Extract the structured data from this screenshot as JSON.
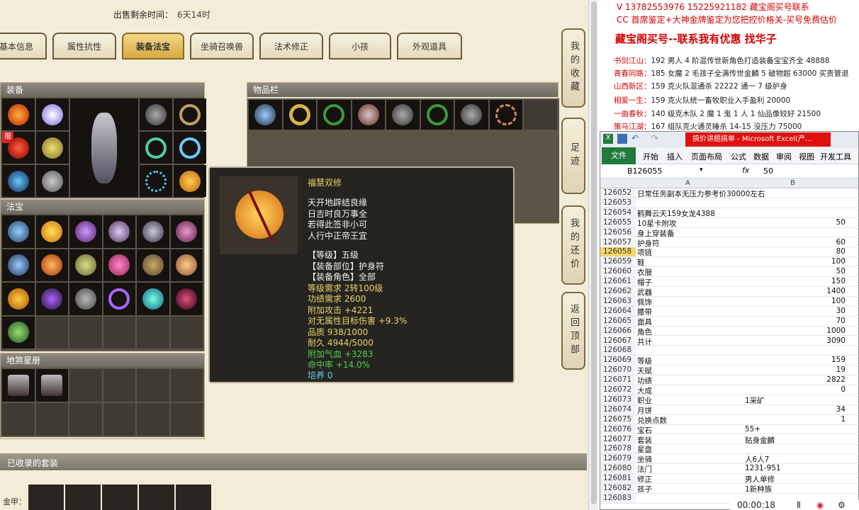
{
  "game": {
    "sale_label": "出售剩余时间：",
    "sale_value": "6天14时",
    "tabs": [
      "基本信息",
      "属性抗性",
      "装备法宝",
      "坐骑召唤兽",
      "法术修正",
      "小孩",
      "外观道具"
    ],
    "active_tab": "装备法宝",
    "sections": {
      "equip": "装备",
      "inventory": "物品栏",
      "fabao": "法宝",
      "dishaxing": "地煞星册",
      "suit": "已收录的套装",
      "suit_label": "金甲："
    },
    "limit_badge": "限",
    "side_buttons": [
      "我的收藏",
      "足迹",
      "我的还价",
      "返回顶部"
    ],
    "tooltip": {
      "name": "福慧双修",
      "poem": [
        "天开地辟结良缘",
        "日吉时良万事全",
        "若得此签非小可",
        "人行中正帝王宜"
      ],
      "attrs": [
        {
          "t": "【等级】五级",
          "c": "w"
        },
        {
          "t": "【装备部位】护身符",
          "c": "w"
        },
        {
          "t": "【装备角色】全部",
          "c": "w"
        },
        {
          "t": "等级需求 2转100级",
          "c": "y"
        },
        {
          "t": "功绩需求 2600",
          "c": "y"
        },
        {
          "t": "附加攻击 +4221",
          "c": "y"
        },
        {
          "t": "对无属性目标伤害 +9.3%",
          "c": "y"
        },
        {
          "t": "品质 938/1000",
          "c": "y"
        },
        {
          "t": "耐久 4944/5000",
          "c": "y"
        },
        {
          "t": "附加气血 +3283",
          "c": "g"
        },
        {
          "t": "命中率 +14.0%",
          "c": "g"
        },
        {
          "t": "培养 0",
          "c": "c"
        }
      ]
    }
  },
  "right": {
    "contact": "V 13782553976   15225921182  藏宝阁买号联系",
    "cc_line": "CC 首席鉴定+大神金牌鉴定为您把控价格关-买号免费估价",
    "headline": "藏宝阁买号--联系我有优惠  找华子",
    "listings": [
      {
        "server": "书剑江山：",
        "text": "192 男人 4 阶混传世新角色打造装备宝宝齐全 48888"
      },
      {
        "server": "青春同路：",
        "text": "185 女魔 2 毛孩子全满传世金麟 5 破物超 63000 买贵管退"
      },
      {
        "server": "山西新区：",
        "text": "159 克火队混通杀 22222 通一 7 级护身"
      },
      {
        "server": "相爱一生：",
        "text": "159 克火队统一畜牧职业入手盈利 20000"
      },
      {
        "server": "一曲春秋：",
        "text": "140 级克木队 2 魔 1 鬼 1 人 1 仙品像较好 21500"
      },
      {
        "server": "策马江湖：",
        "text": "167 组队克火通灵睡杀 14-15 没压力 75000"
      }
    ],
    "excel": {
      "title": "搞价讲题搞单 - Microsoft Excel(产...",
      "file": "文件",
      "menu": [
        "开始",
        "插入",
        "页面布局",
        "公式",
        "数据",
        "审阅",
        "视图",
        "开发工具"
      ],
      "cell_ref": "B126055",
      "fx": "fx",
      "formula": "50",
      "col_a": "A",
      "col_b": "B",
      "rows": [
        {
          "n": "126052",
          "a": "日常任务副本无压力参考价30000左右",
          "b": ""
        },
        {
          "n": "126053",
          "a": "",
          "b": ""
        },
        {
          "n": "126054",
          "a": "鹤舞云天159女龙4388",
          "b": ""
        },
        {
          "n": "126055",
          "a": "10星卡附攻",
          "b": "50"
        },
        {
          "n": "126056",
          "a": "身上穿装备",
          "b": ""
        },
        {
          "n": "126057",
          "a": "护身符",
          "b": "60"
        },
        {
          "n": "126058",
          "a": "项链",
          "b": "80"
        },
        {
          "n": "126059",
          "a": "鞋",
          "b": "100"
        },
        {
          "n": "126060",
          "a": "衣服",
          "b": "50"
        },
        {
          "n": "126061",
          "a": "帽子",
          "b": "150"
        },
        {
          "n": "126062",
          "a": "武器",
          "b": "1400"
        },
        {
          "n": "126063",
          "a": "佩饰",
          "b": "100"
        },
        {
          "n": "126064",
          "a": "腰带",
          "b": "30"
        },
        {
          "n": "126065",
          "a": "面具",
          "b": "70"
        },
        {
          "n": "126066",
          "a": "角色",
          "b": "1000"
        },
        {
          "n": "126067",
          "a": "共计",
          "b": "3090"
        },
        {
          "n": "126068",
          "a": "",
          "b": ""
        },
        {
          "n": "126069",
          "a": "等级",
          "b": "159"
        },
        {
          "n": "126070",
          "a": "天赋",
          "b": "19"
        },
        {
          "n": "126071",
          "a": "功绩",
          "b": "2822"
        },
        {
          "n": "126072",
          "a": "大成",
          "b": "0"
        },
        {
          "n": "126073",
          "a": "职业",
          "bl": "1采矿"
        },
        {
          "n": "126074",
          "a": "月饼",
          "b": "34"
        },
        {
          "n": "126075",
          "a": "兑换点数",
          "b": "1"
        },
        {
          "n": "126076",
          "a": "宝石",
          "bl": "55+"
        },
        {
          "n": "126077",
          "a": "套装",
          "bl": "贴身金麟"
        },
        {
          "n": "126078",
          "a": "星盘",
          "b": ""
        },
        {
          "n": "126079",
          "a": "坐骑",
          "bl": "人6人7"
        },
        {
          "n": "126080",
          "a": "法门",
          "bl": "1231-951"
        },
        {
          "n": "126081",
          "a": "修正",
          "bl": "男人单修"
        },
        {
          "n": "126082",
          "a": "孩子",
          "bl": "1新种族"
        },
        {
          "n": "126083",
          "a": "",
          "b": ""
        }
      ]
    },
    "player_time": "00:00:18"
  }
}
